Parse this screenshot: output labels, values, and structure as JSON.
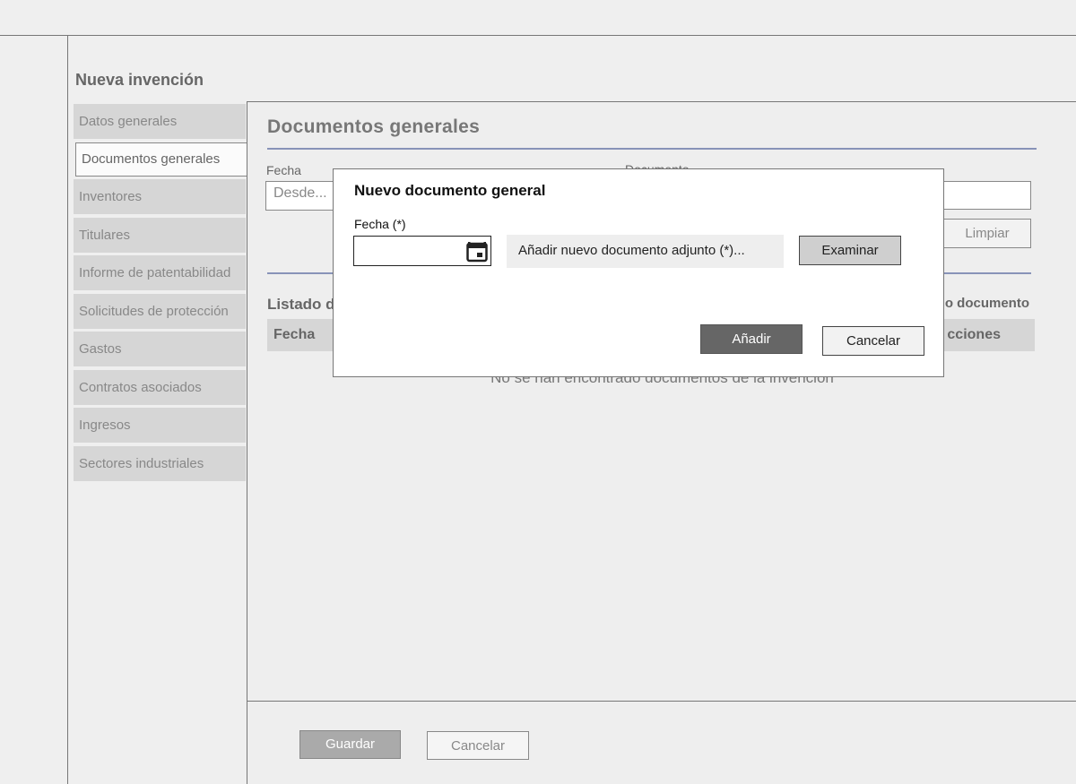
{
  "page": {
    "title": "Nueva invención"
  },
  "sidebar": {
    "items": [
      {
        "label": "Datos generales"
      },
      {
        "label": "Documentos generales"
      },
      {
        "label": "Inventores"
      },
      {
        "label": "Titulares"
      },
      {
        "label": "Informe de patentabilidad"
      },
      {
        "label": "Solicitudes de protección"
      },
      {
        "label": "Gastos"
      },
      {
        "label": "Contratos asociados"
      },
      {
        "label": "Ingresos"
      },
      {
        "label": "Sectores industriales"
      }
    ],
    "active_index": 1
  },
  "main": {
    "section_title": "Documentos generales",
    "filters": {
      "fecha_label": "Fecha",
      "desde_placeholder": "Desde...",
      "documento_label": "Documento",
      "limpiar_label": "Limpiar"
    },
    "list": {
      "title": "Listado d",
      "nuevo_documento": "o documento",
      "columns": [
        "Fecha",
        "cciones"
      ],
      "empty_message": "No se han encontrado documentos de la invención"
    },
    "footer": {
      "guardar_label": "Guardar",
      "cancelar_label": "Cancelar"
    }
  },
  "modal": {
    "title": "Nuevo documento general",
    "fecha_label": "Fecha (*)",
    "fecha_value": "",
    "adjunto_placeholder": "Añadir nuevo documento adjunto (*)...",
    "examinar_label": "Examinar",
    "anadir_label": "Añadir",
    "cancelar_label": "Cancelar",
    "icons": {
      "date_picker": "calendar-icon"
    }
  }
}
